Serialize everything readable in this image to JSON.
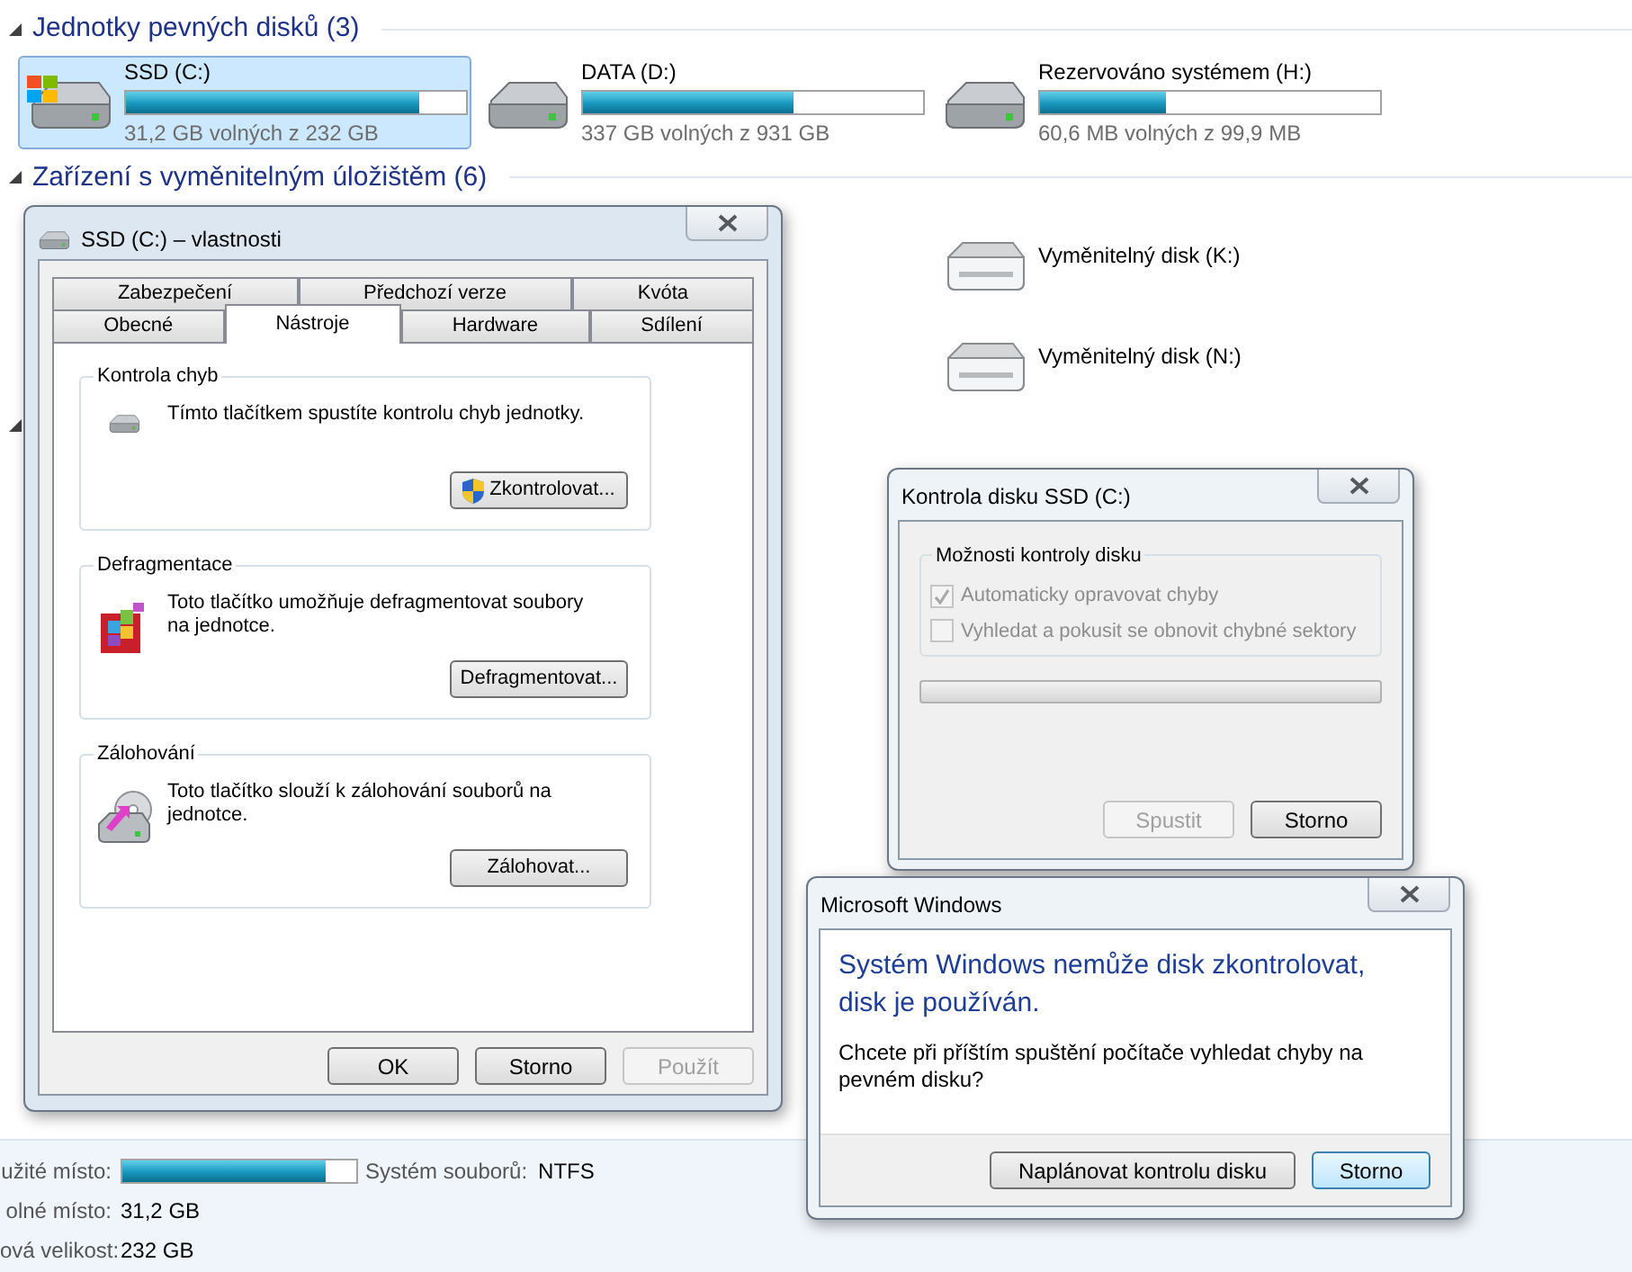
{
  "explorer": {
    "sections": [
      {
        "title": "Jednotky pevných disků (3)",
        "drives": [
          {
            "name": "SSD (C:)",
            "level": 0.86,
            "free": "31,2 GB volných z 232 GB",
            "selected": true,
            "kind": "system"
          },
          {
            "name": "DATA (D:)",
            "level": 0.62,
            "free": "337 GB volných z 931 GB",
            "selected": false,
            "kind": "disk"
          },
          {
            "name": "Rezervováno systémem (H:)",
            "level": 0.37,
            "free": "60,6 MB volných z 99,9 MB",
            "selected": false,
            "kind": "disk"
          }
        ]
      },
      {
        "title": "Zařízení s vyměnitelným úložištěm (6)",
        "drives": [
          {
            "name": "Vyměnitelný disk (K:)",
            "selected": false,
            "kind": "removable"
          },
          {
            "name": "Vyměnitelný disk (N:)",
            "selected": false,
            "kind": "removable"
          }
        ]
      }
    ],
    "details": {
      "used_label": "užité místo:",
      "level": 0.87,
      "fs_label": "Systém souborů:",
      "fs_value": "NTFS",
      "free_label": "olné místo:",
      "free_value": "31,2 GB",
      "size_label": "ová velikost:",
      "size_value": "232 GB"
    }
  },
  "properties_dialog": {
    "title": "SSD (C:) – vlastnosti",
    "tab_rows": [
      [
        {
          "label": "Zabezpečení",
          "selected": false
        },
        {
          "label": "Předchozí verze",
          "selected": false
        },
        {
          "label": "Kvóta",
          "selected": false
        }
      ],
      [
        {
          "label": "Obecné",
          "selected": false
        },
        {
          "label": "Nástroje",
          "selected": true
        },
        {
          "label": "Hardware",
          "selected": false
        },
        {
          "label": "Sdílení",
          "selected": false
        }
      ]
    ],
    "groups": [
      {
        "title": "Kontrola chyb",
        "kind": "check",
        "text": "Tímto tlačítkem spustíte kontrolu chyb jednotky.",
        "button": "Zkontrolovat..."
      },
      {
        "title": "Defragmentace",
        "kind": "defrag",
        "text": "Toto tlačítko umožňuje defragmentovat soubory na jednotce.",
        "button": "Defragmentovat..."
      },
      {
        "title": "Zálohování",
        "kind": "backup",
        "text": "Toto tlačítko slouží k zálohování souborů na jednotce.",
        "button": "Zálohovat..."
      }
    ],
    "buttons": [
      {
        "label": "OK",
        "disabled": false
      },
      {
        "label": "Storno",
        "disabled": false
      },
      {
        "label": "Použít",
        "disabled": true
      }
    ]
  },
  "check_dialog": {
    "title": "Kontrola disku SSD (C:)",
    "group_title": "Možnosti kontroly disku",
    "options": [
      {
        "label": "Automaticky opravovat chyby",
        "checked": true,
        "disabled": true
      },
      {
        "label": "Vyhledat a pokusit se obnovit chybné sektory",
        "checked": false,
        "disabled": true
      }
    ],
    "buttons": [
      {
        "label": "Spustit",
        "disabled": true
      },
      {
        "label": "Storno",
        "disabled": false
      }
    ]
  },
  "message_box": {
    "title": "Microsoft Windows",
    "heading": "Systém Windows nemůže disk zkontrolovat, disk je používán.",
    "text": "Chcete při příštím spuštění počítače vyhledat chyby na pevném disku?",
    "buttons": [
      {
        "label": "Naplánovat kontrolu disku",
        "default": false
      },
      {
        "label": "Storno",
        "default": true
      }
    ]
  }
}
